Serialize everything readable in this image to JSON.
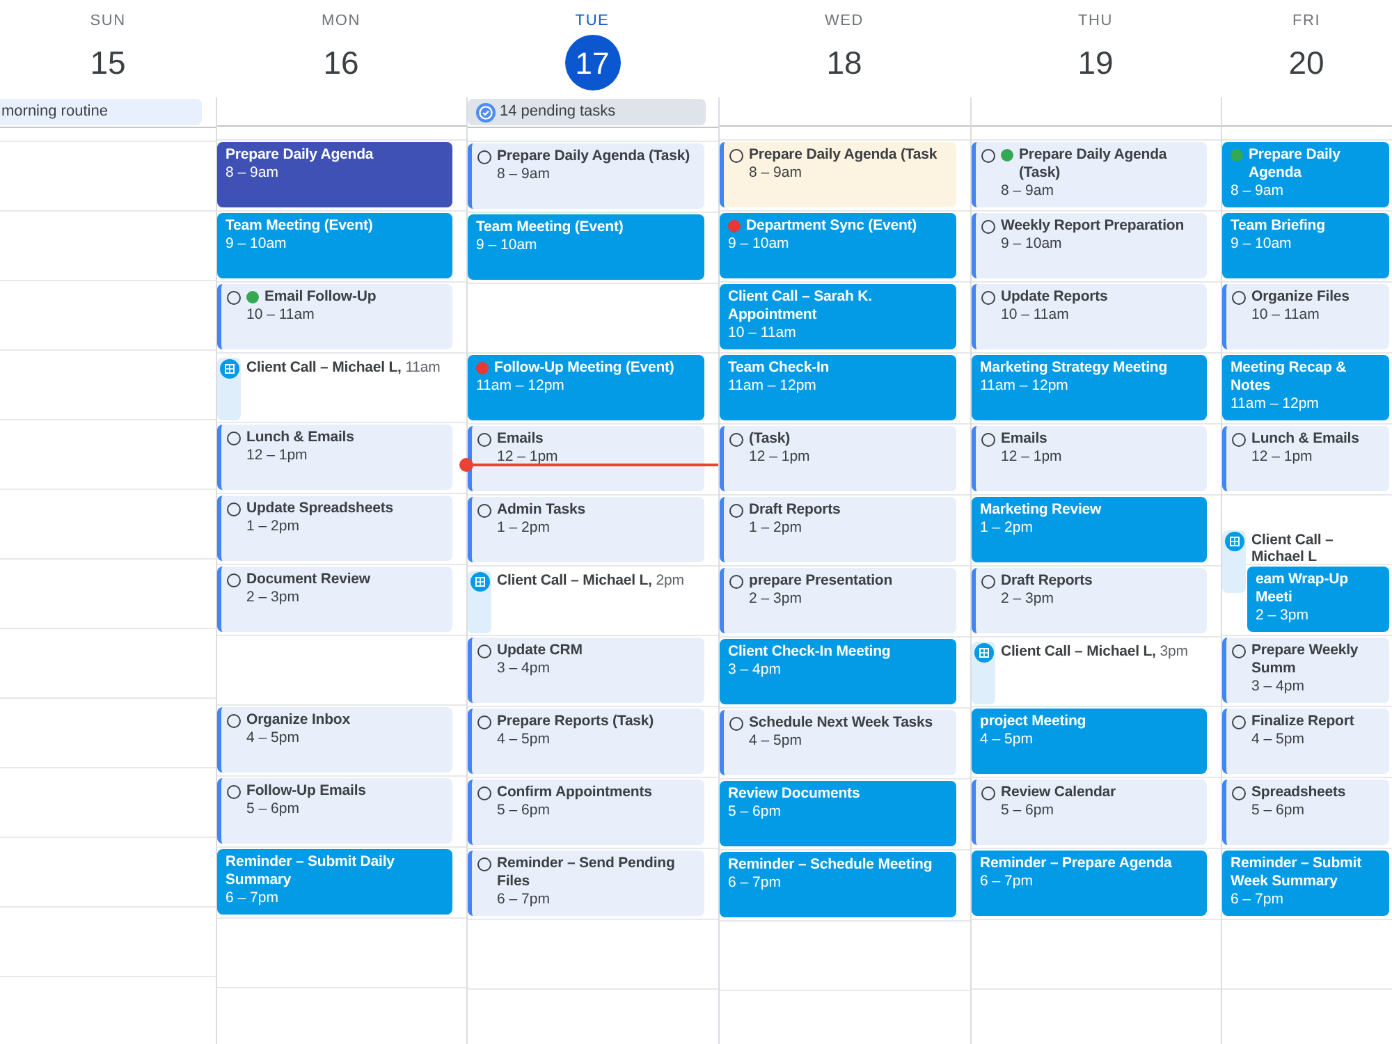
{
  "days": [
    {
      "weekday": "SUN",
      "date": "15",
      "today": false,
      "all_day": [
        {
          "kind": "event",
          "title": "morning routine",
          "color": "#e8f0fe"
        }
      ]
    },
    {
      "weekday": "MON",
      "date": "16",
      "today": false,
      "events": [
        {
          "kind": "event",
          "title": "Prepare Daily Agenda",
          "time": "8 – 9am",
          "color": "#3f51b5"
        },
        {
          "kind": "event",
          "title": "Team Meeting (Event)",
          "time": "9 – 10am",
          "color": "#039be5"
        },
        {
          "kind": "task",
          "title": "Email Follow-Up",
          "time": "10 – 11am",
          "color": "#e8effb",
          "dot": {
            "color": "#34a853"
          }
        },
        {
          "kind": "appointment",
          "title": "Client Call – Michael L,",
          "time": "11am"
        },
        {
          "kind": "task",
          "title": "Lunch & Emails",
          "time": "12 – 1pm",
          "color": "#e8effb"
        },
        {
          "kind": "task",
          "title": "Update Spreadsheets",
          "time": "1 – 2pm",
          "color": "#e8effb"
        },
        {
          "kind": "task",
          "title": "Document Review",
          "time": "2 – 3pm",
          "color": "#e8effb"
        },
        {
          "kind": "free"
        },
        {
          "kind": "task",
          "title": "Organize Inbox",
          "time": "4 – 5pm",
          "color": "#e8effb"
        },
        {
          "kind": "task",
          "title": "Follow-Up Emails",
          "time": "5 – 6pm",
          "color": "#e8effb"
        },
        {
          "kind": "event",
          "title": "Reminder – Submit Daily Summary",
          "time": "6 – 7pm",
          "color": "#039be5"
        }
      ]
    },
    {
      "weekday": "TUE",
      "date": "17",
      "today": true,
      "all_day": [
        {
          "kind": "tasks",
          "title": "14 pending tasks",
          "color": "#dfe3ea"
        }
      ],
      "events": [
        {
          "kind": "task",
          "title": "Prepare Daily Agenda (Task)",
          "time": "8 – 9am",
          "color": "#e8effb"
        },
        {
          "kind": "event",
          "title": "Team Meeting (Event)",
          "time": "9 – 10am",
          "color": "#039be5"
        },
        {
          "kind": "free"
        },
        {
          "kind": "event",
          "title": "Follow-Up Meeting (Event)",
          "time": "11am – 12pm",
          "color": "#039be5",
          "dot": {
            "color": "#e53935"
          }
        },
        {
          "kind": "task",
          "title": "Emails",
          "time": "12 – 1pm",
          "color": "#e8effb"
        },
        {
          "kind": "task",
          "title": "Admin Tasks",
          "time": "1 – 2pm",
          "color": "#e8effb"
        },
        {
          "kind": "appointment",
          "title": "Client Call – Michael L,",
          "time": "2pm"
        },
        {
          "kind": "task",
          "title": "Update CRM",
          "time": "3 – 4pm",
          "color": "#e8effb"
        },
        {
          "kind": "task",
          "title": "Prepare Reports (Task)",
          "time": "4 – 5pm",
          "color": "#e8effb"
        },
        {
          "kind": "task",
          "title": "Confirm Appointments",
          "time": "5 – 6pm",
          "color": "#e8effb"
        },
        {
          "kind": "task",
          "title": "Reminder – Send Pending Files",
          "time": "6 – 7pm",
          "color": "#e8effb"
        }
      ]
    },
    {
      "weekday": "WED",
      "date": "18",
      "today": false,
      "events": [
        {
          "kind": "task",
          "title": "Prepare Daily Agenda (Task",
          "time": "8 – 9am",
          "color": "#fdf3e1"
        },
        {
          "kind": "event",
          "title": "Department Sync (Event)",
          "time": "9 – 10am",
          "color": "#039be5",
          "dot": {
            "color": "#e53935"
          }
        },
        {
          "kind": "event",
          "title": "Client Call – Sarah K. Appointment",
          "time": "10 – 11am",
          "color": "#039be5"
        },
        {
          "kind": "event",
          "title": "Team Check-In",
          "time": "11am – 12pm",
          "color": "#039be5"
        },
        {
          "kind": "task",
          "title": "(Task)",
          "time": "12 – 1pm",
          "color": "#e8effb"
        },
        {
          "kind": "task",
          "title": "Draft Reports",
          "time": "1 – 2pm",
          "color": "#e8effb"
        },
        {
          "kind": "task",
          "title": "prepare Presentation",
          "time": "2 – 3pm",
          "color": "#e8effb"
        },
        {
          "kind": "event",
          "title": "Client Check-In Meeting",
          "time": "3 – 4pm",
          "color": "#039be5"
        },
        {
          "kind": "task",
          "title": "Schedule Next Week Tasks",
          "time": "4 – 5pm",
          "color": "#e8effb"
        },
        {
          "kind": "event",
          "title": "Review Documents",
          "time": "5 – 6pm",
          "color": "#039be5"
        },
        {
          "kind": "event",
          "title": "Reminder – Schedule Meeting",
          "time": "6 – 7pm",
          "color": "#039be5"
        }
      ]
    },
    {
      "weekday": "THU",
      "date": "19",
      "today": false,
      "events": [
        {
          "kind": "task",
          "title": "Prepare Daily Agenda (Task)",
          "time": "8 – 9am",
          "color": "#e8effb",
          "dot": {
            "color": "#34a853"
          }
        },
        {
          "kind": "task",
          "title": "Weekly Report Preparation",
          "time": "9 – 10am",
          "color": "#e8effb"
        },
        {
          "kind": "task",
          "title": "Update Reports",
          "time": "10 – 11am",
          "color": "#e8effb"
        },
        {
          "kind": "event",
          "title": "Marketing Strategy Meeting",
          "time": "11am – 12pm",
          "color": "#039be5"
        },
        {
          "kind": "task",
          "title": "Emails",
          "time": "12 – 1pm",
          "color": "#e8effb"
        },
        {
          "kind": "event",
          "title": "Marketing Review",
          "time": "1 – 2pm",
          "color": "#039be5"
        },
        {
          "kind": "task",
          "title": "Draft Reports",
          "time": "2 – 3pm",
          "color": "#e8effb"
        },
        {
          "kind": "appointment",
          "title": "Client Call – Michael L,",
          "time": "3pm"
        },
        {
          "kind": "event",
          "title": "project Meeting",
          "time": "4 – 5pm",
          "color": "#039be5"
        },
        {
          "kind": "task",
          "title": "Review Calendar",
          "time": "5 – 6pm",
          "color": "#e8effb"
        },
        {
          "kind": "event",
          "title": "Reminder – Prepare Agenda",
          "time": "6 – 7pm",
          "color": "#039be5"
        }
      ]
    },
    {
      "weekday": "FRI",
      "date": "20",
      "today": false,
      "events": [
        {
          "kind": "event",
          "title": "Prepare Daily Agenda",
          "time": "8 – 9am",
          "color": "#039be5",
          "dot": {
            "color": "#34a853"
          }
        },
        {
          "kind": "event",
          "title": "Team Briefing",
          "time": "9 – 10am",
          "color": "#039be5"
        },
        {
          "kind": "task",
          "title": "Organize Files",
          "time": "10 – 11am",
          "color": "#e8effb"
        },
        {
          "kind": "event",
          "title": "Meeting Recap & Notes",
          "time": "11am – 12pm",
          "color": "#039be5"
        },
        {
          "kind": "task",
          "title": "Lunch & Emails",
          "time": "12 – 1pm",
          "color": "#e8effb"
        },
        {
          "kind": "free"
        },
        {
          "kind": "event",
          "title": "eam Wrap-Up Meeti",
          "time": "2 – 3pm",
          "color": "#039be5",
          "overlapping_appointment": {
            "title": "Client Call – Michael L"
          }
        },
        {
          "kind": "task",
          "title": "Prepare Weekly Summ",
          "time": "3 – 4pm",
          "color": "#e8effb"
        },
        {
          "kind": "task",
          "title": "Finalize Report",
          "time": "4 – 5pm",
          "color": "#e8effb"
        },
        {
          "kind": "task",
          "title": "Spreadsheets",
          "time": "5 – 6pm",
          "color": "#e8effb"
        },
        {
          "kind": "event",
          "title": "Reminder – Submit Week Summary",
          "time": "6 – 7pm",
          "color": "#039be5"
        }
      ]
    }
  ]
}
